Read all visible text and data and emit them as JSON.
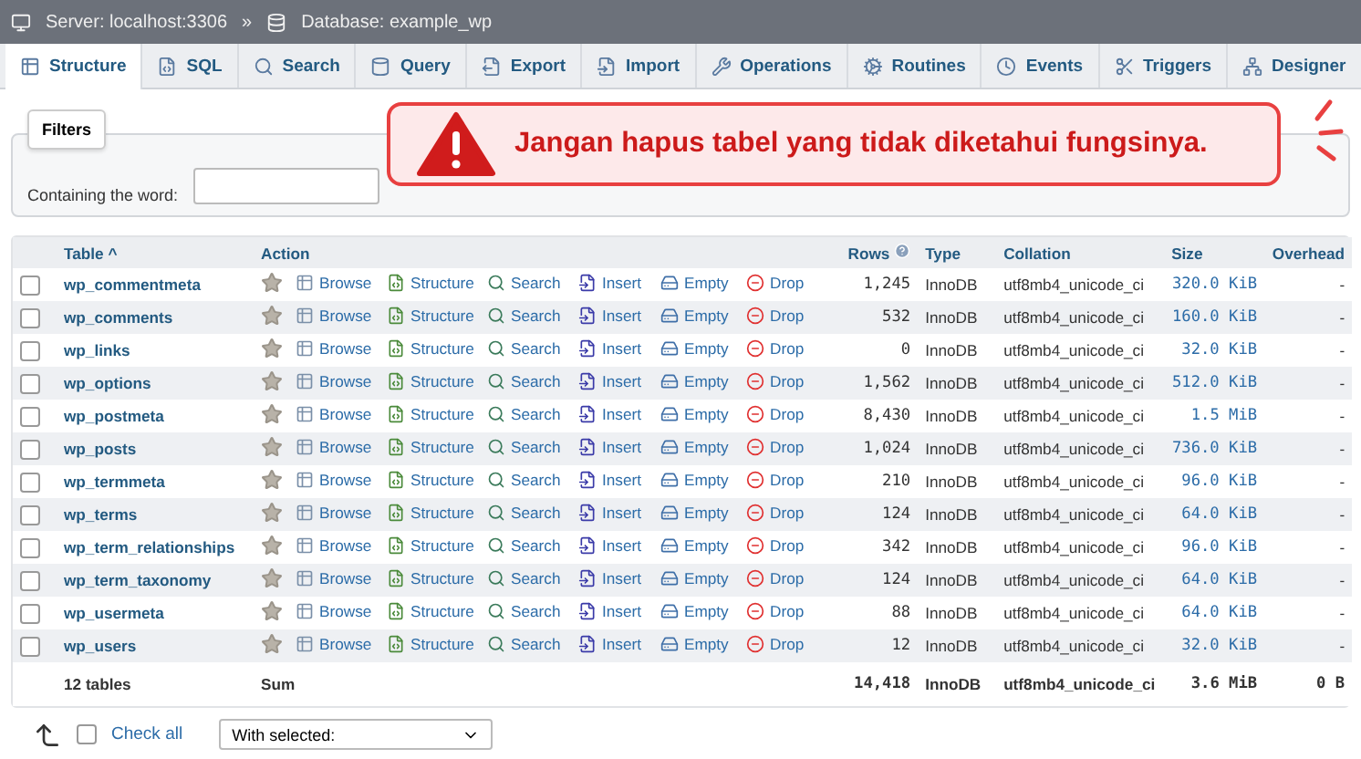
{
  "breadcrumb": {
    "server": "Server: localhost:3306",
    "separator": "»",
    "database": "Database: example_wp"
  },
  "tabs": [
    {
      "label": "Structure",
      "selected": true
    },
    {
      "label": "SQL",
      "selected": false
    },
    {
      "label": "Search",
      "selected": false
    },
    {
      "label": "Query",
      "selected": false
    },
    {
      "label": "Export",
      "selected": false
    },
    {
      "label": "Import",
      "selected": false
    },
    {
      "label": "Operations",
      "selected": false
    },
    {
      "label": "Routines",
      "selected": false
    },
    {
      "label": "Events",
      "selected": false
    },
    {
      "label": "Triggers",
      "selected": false
    },
    {
      "label": "Designer",
      "selected": false
    }
  ],
  "filters": {
    "legend": "Filters",
    "label": "Containing the word:"
  },
  "alert": {
    "message": "Jangan hapus tabel yang tidak diketahui fungsinya."
  },
  "table": {
    "columns": {
      "table": "Table",
      "sort": "^",
      "action": "Action",
      "rows": "Rows",
      "type": "Type",
      "collation": "Collation",
      "size": "Size",
      "overhead": "Overhead"
    },
    "rows": [
      {
        "name": "wp_commentmeta",
        "checked": false,
        "favorite": false,
        "actions": [
          "Browse",
          "Structure",
          "Search",
          "Insert",
          "Empty",
          "Drop"
        ],
        "rows": "1,245",
        "type": "InnoDB",
        "collation": "utf8mb4_unicode_ci",
        "size": "320.0 KiB",
        "overhead": "-"
      },
      {
        "name": "wp_comments",
        "checked": false,
        "favorite": false,
        "actions": [
          "Browse",
          "Structure",
          "Search",
          "Insert",
          "Empty",
          "Drop"
        ],
        "rows": "532",
        "type": "InnoDB",
        "collation": "utf8mb4_unicode_ci",
        "size": "160.0 KiB",
        "overhead": "-"
      },
      {
        "name": "wp_links",
        "checked": false,
        "favorite": false,
        "actions": [
          "Browse",
          "Structure",
          "Search",
          "Insert",
          "Empty",
          "Drop"
        ],
        "rows": "0",
        "type": "InnoDB",
        "collation": "utf8mb4_unicode_ci",
        "size": "32.0 KiB",
        "overhead": "-"
      },
      {
        "name": "wp_options",
        "checked": false,
        "favorite": false,
        "actions": [
          "Browse",
          "Structure",
          "Search",
          "Insert",
          "Empty",
          "Drop"
        ],
        "rows": "1,562",
        "type": "InnoDB",
        "collation": "utf8mb4_unicode_ci",
        "size": "512.0 KiB",
        "overhead": "-"
      },
      {
        "name": "wp_postmeta",
        "checked": false,
        "favorite": false,
        "actions": [
          "Browse",
          "Structure",
          "Search",
          "Insert",
          "Empty",
          "Drop"
        ],
        "rows": "8,430",
        "type": "InnoDB",
        "collation": "utf8mb4_unicode_ci",
        "size": "1.5 MiB",
        "overhead": "-"
      },
      {
        "name": "wp_posts",
        "checked": false,
        "favorite": false,
        "actions": [
          "Browse",
          "Structure",
          "Search",
          "Insert",
          "Empty",
          "Drop"
        ],
        "rows": "1,024",
        "type": "InnoDB",
        "collation": "utf8mb4_unicode_ci",
        "size": "736.0 KiB",
        "overhead": "-"
      },
      {
        "name": "wp_termmeta",
        "checked": false,
        "favorite": false,
        "actions": [
          "Browse",
          "Structure",
          "Search",
          "Insert",
          "Empty",
          "Drop"
        ],
        "rows": "210",
        "type": "InnoDB",
        "collation": "utf8mb4_unicode_ci",
        "size": "96.0 KiB",
        "overhead": "-"
      },
      {
        "name": "wp_terms",
        "checked": false,
        "favorite": false,
        "actions": [
          "Browse",
          "Structure",
          "Search",
          "Insert",
          "Empty",
          "Drop"
        ],
        "rows": "124",
        "type": "InnoDB",
        "collation": "utf8mb4_unicode_ci",
        "size": "64.0 KiB",
        "overhead": "-"
      },
      {
        "name": "wp_term_relationships",
        "checked": false,
        "favorite": false,
        "actions": [
          "Browse",
          "Structure",
          "Search",
          "Insert",
          "Empty",
          "Drop"
        ],
        "rows": "342",
        "type": "InnoDB",
        "collation": "utf8mb4_unicode_ci",
        "size": "96.0 KiB",
        "overhead": "-"
      },
      {
        "name": "wp_term_taxonomy",
        "checked": false,
        "favorite": false,
        "actions": [
          "Browse",
          "Structure",
          "Search",
          "Insert",
          "Empty",
          "Drop"
        ],
        "rows": "124",
        "type": "InnoDB",
        "collation": "utf8mb4_unicode_ci",
        "size": "64.0 KiB",
        "overhead": "-"
      },
      {
        "name": "wp_usermeta",
        "checked": false,
        "favorite": false,
        "actions": [
          "Browse",
          "Structure",
          "Search",
          "Insert",
          "Empty",
          "Drop"
        ],
        "rows": "88",
        "type": "InnoDB",
        "collation": "utf8mb4_unicode_ci",
        "size": "64.0 KiB",
        "overhead": "-"
      },
      {
        "name": "wp_users",
        "checked": false,
        "favorite": false,
        "actions": [
          "Browse",
          "Structure",
          "Search",
          "Insert",
          "Empty",
          "Drop"
        ],
        "rows": "12",
        "type": "InnoDB",
        "collation": "utf8mb4_unicode_ci",
        "size": "32.0 KiB",
        "overhead": "-"
      }
    ],
    "footer": {
      "tables": "12 tables",
      "sum": "Sum",
      "rows": "14,418",
      "type": "InnoDB",
      "collation": "utf8mb4_unicode_ci",
      "size": "3.6 MiB",
      "overhead": "0 B"
    }
  },
  "bottom": {
    "check_all": {
      "label": "Check all",
      "checked": false
    },
    "with_selected": {
      "value": "With selected:"
    }
  }
}
